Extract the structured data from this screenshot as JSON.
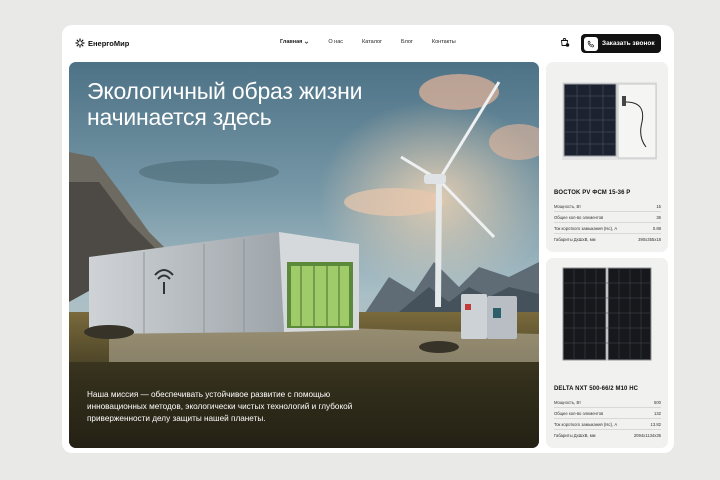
{
  "header": {
    "logo_text": "ЕнергоМир",
    "nav": [
      {
        "label": "Главная"
      },
      {
        "label": "О нас"
      },
      {
        "label": "Каталог"
      },
      {
        "label": "Блог"
      },
      {
        "label": "Контакты"
      }
    ],
    "cta_label": "Заказать звонок"
  },
  "hero": {
    "title": "Экологичный образ жизни начинается здесь",
    "mission": "Наша миссия — обеспечивать устойчивое развитие с помощью инновационных методов, экологически чистых технологий и глубокой приверженности делу защиты нашей планеты."
  },
  "products": [
    {
      "name": "BOCTOK PV ФСМ 15-36 P",
      "specs": [
        {
          "label": "Мощность, Вт",
          "value": "15"
        },
        {
          "label": "Общее кол-во элементов",
          "value": "36"
        },
        {
          "label": "Ток короткого замыкания (Isc), А",
          "value": "0.88"
        },
        {
          "label": "Габариты ДхШхВ, мм",
          "value": "390х355х18"
        }
      ]
    },
    {
      "name": "DELTA NXT 500-66/2 M10 HC",
      "specs": [
        {
          "label": "Мощность, Вт",
          "value": "500"
        },
        {
          "label": "Общее кол-во элементов",
          "value": "132"
        },
        {
          "label": "Ток короткого замыкания (Isc), А",
          "value": "13.82"
        },
        {
          "label": "Габариты ДхШхВ, мм",
          "value": "2094х1134х35"
        }
      ]
    }
  ],
  "colors": {
    "accent": "#111111",
    "card": "#ffffff",
    "panel": "#f1f1f0"
  }
}
